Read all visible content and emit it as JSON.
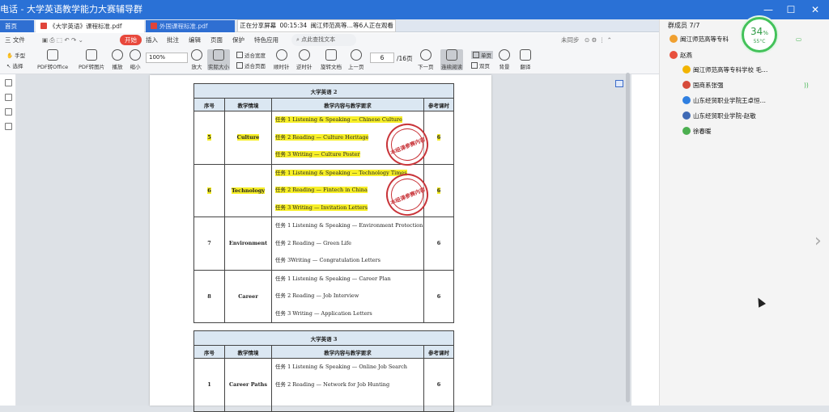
{
  "window": {
    "title": "电话 - 大学英语教学能力大赛辅导群"
  },
  "tabs": [
    {
      "label": "首页"
    },
    {
      "label": "《大学英语》课程标准.pdf"
    },
    {
      "label": "外国课程标准.pdf"
    }
  ],
  "share_banner": {
    "status": "正在分享屏幕",
    "time": "00:15:34",
    "viewers": "闽江师范高等…等6人正在观看"
  },
  "menu": {
    "file": "三 文件",
    "start": "开始",
    "items": [
      "插入",
      "批注",
      "编辑",
      "页面",
      "保护",
      "特色应用"
    ],
    "search": "点此查找文本",
    "sync": "未同步"
  },
  "toolbar": {
    "hand": "手型",
    "select": "选择",
    "pdf_office": "PDF转Office",
    "pdf_image": "PDF转图片",
    "play": "播放",
    "zoom_out": "缩小",
    "zoom": "100%",
    "zoom_in": "放大",
    "actual": "实际大小",
    "fit_width": "适合宽度",
    "fit_page": "适合页面",
    "rot_cw": "顺时针",
    "rot_ccw": "逆时针",
    "rotate_doc": "旋转文档",
    "prev": "上一页",
    "page": "6",
    "total": "/16页",
    "next": "下一页",
    "continuous": "连续阅读",
    "single": "单页",
    "double": "双页",
    "bg": "背景",
    "translate": "翻译"
  },
  "doc": {
    "table2": {
      "caption": "大学英语 2",
      "headers": [
        "序号",
        "教学情境",
        "教学内容与教学要求",
        "参考课时"
      ],
      "rows": [
        {
          "num": "5",
          "theme": "Culture",
          "hours": "6",
          "highlight": true,
          "tasks": [
            "任务 1 Listening & Speaking — Chinese Culture",
            "任务 2 Reading — Culture Heritage",
            "任务 3 Writing — Culture Poster"
          ]
        },
        {
          "num": "6",
          "theme": "Technology",
          "hours": "6",
          "highlight": true,
          "tasks": [
            "任务 1 Listening & Speaking — Technology Times",
            "任务 2 Reading — Fintech in China",
            "任务 3 Writing — Invitation Letters"
          ]
        },
        {
          "num": "7",
          "theme": "Environment",
          "hours": "6",
          "highlight": false,
          "tasks": [
            "任务 1 Listening & Speaking — Environment Protection",
            "任务 2 Reading — Green Life",
            "任务 3Writing — Congratulation Letters"
          ]
        },
        {
          "num": "8",
          "theme": "Career",
          "hours": "6",
          "highlight": false,
          "tasks": [
            "任务 1 Listening & Speaking — Career Plan",
            "任务 2 Reading — Job Interview",
            "任务 3 Writing — Application Letters"
          ]
        }
      ]
    },
    "table3": {
      "caption": "大学英语 3",
      "headers": [
        "序号",
        "教学情境",
        "教学内容与教学要求",
        "参考课时"
      ],
      "rows": [
        {
          "num": "1",
          "theme": "Career Paths",
          "hours": "6",
          "tasks": [
            "任务 1 Listening & Speaking — Online Job Search",
            "任务 2 Reading — Network for Job Hunting"
          ]
        }
      ]
    },
    "stamp_text": "本组课参赛内容"
  },
  "chat": {
    "header": "群成员 7/7",
    "gauge_percent": "34",
    "gauge_unit": "%",
    "gauge_temp": "55°C",
    "members": [
      "闽江师范高等专科",
      "赵燕",
      "闽江师范高等专科学校 毛…",
      "国商系张强",
      "山东经贸职业学院王卓恒…",
      "山东经贸职业学院-赵敬",
      "徐春暖"
    ],
    "colors": [
      "#f0a030",
      "#e8503c",
      "#f2b400",
      "#d64b3a",
      "#2f7fe0",
      "#3f6ab5",
      "#4caf50"
    ]
  }
}
